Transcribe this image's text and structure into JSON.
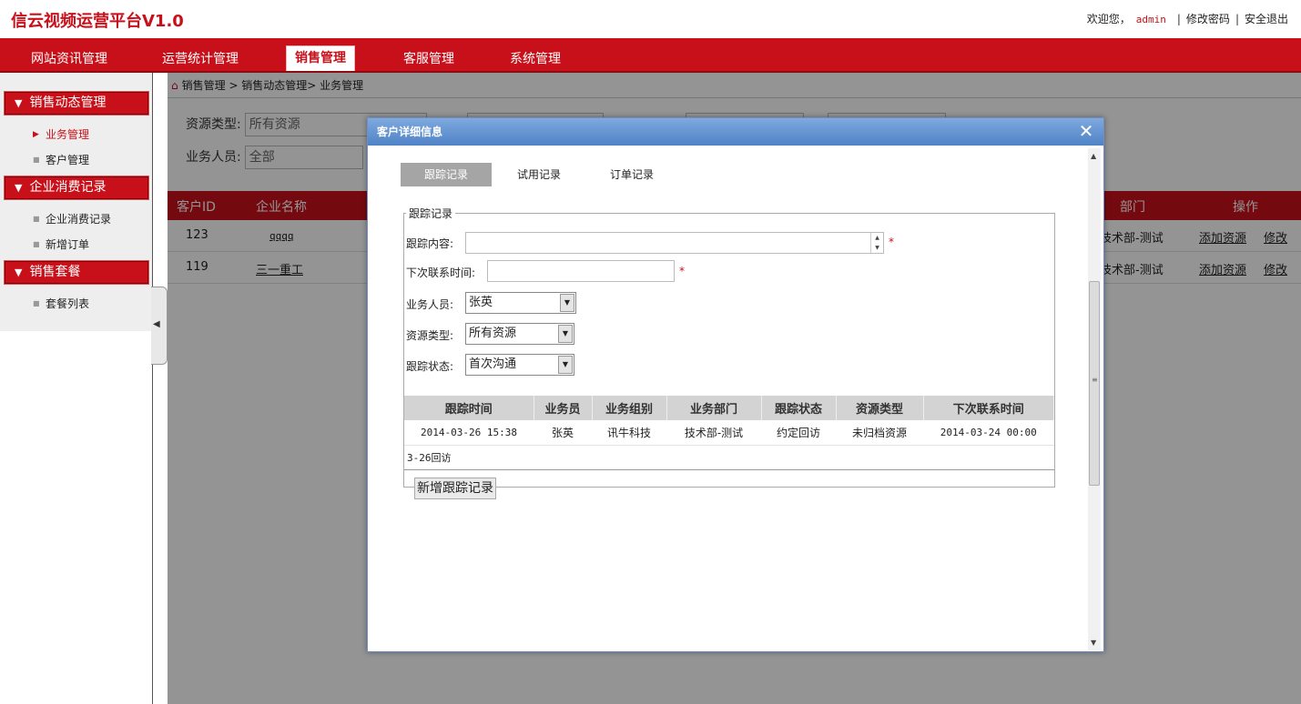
{
  "app": {
    "title": "信云视频运营平台V1.0",
    "welcome": "欢迎您，",
    "username": "admin",
    "change_password": "修改密码",
    "logout": "安全退出"
  },
  "nav": {
    "items": [
      "网站资讯管理",
      "运营统计管理",
      "销售管理",
      "客服管理",
      "系统管理"
    ],
    "active": "销售管理"
  },
  "sidebar": {
    "groups": [
      {
        "label": "销售动态管理",
        "items": [
          "业务管理",
          "客户管理"
        ]
      },
      {
        "label": "企业消费记录",
        "items": [
          "企业消费记录",
          "新增订单"
        ]
      },
      {
        "label": "销售套餐",
        "items": [
          "套餐列表"
        ]
      }
    ],
    "active_item": "业务管理"
  },
  "main": {
    "breadcrumb": "销售管理 > 销售动态管理> 业务管理",
    "filters": {
      "resource_type_label": "资源类型:",
      "resource_type_value": "所有资源",
      "salesperson_label": "业务人员:",
      "salesperson_value": "全部"
    },
    "table": {
      "headers": [
        "客户ID",
        "企业名称",
        "部门",
        "操作"
      ],
      "rows": [
        {
          "id": "123",
          "name": "qqqq",
          "dept": "技术部-测试",
          "action1": "添加资源",
          "action2": "修改"
        },
        {
          "id": "119",
          "name": "三一重工",
          "dept": "技术部-测试",
          "action1": "添加资源",
          "action2": "修改"
        }
      ]
    }
  },
  "modal": {
    "title": "客户详细信息",
    "tabs": [
      "跟踪记录",
      "试用记录",
      "订单记录"
    ],
    "active_tab": "跟踪记录",
    "section_legend": "跟踪记录",
    "form": {
      "content_label": "跟踪内容:",
      "next_time_label": "下次联系时间:",
      "salesperson_label": "业务人员:",
      "salesperson_value": "张英",
      "resource_type_label": "资源类型:",
      "resource_type_value": "所有资源",
      "status_label": "跟踪状态:",
      "status_value": "首次沟通",
      "required_mark": "*"
    },
    "records": {
      "headers": [
        "跟踪时间",
        "业务员",
        "业务组别",
        "业务部门",
        "跟踪状态",
        "资源类型",
        "下次联系时间"
      ],
      "rows": [
        [
          "2014-03-26 15:38",
          "张英",
          "讯牛科技",
          "技术部-测试",
          "约定回访",
          "未归档资源",
          "2014-03-24 00:00"
        ]
      ],
      "remark": "3-26回访"
    },
    "add_button": "新增跟踪记录"
  }
}
